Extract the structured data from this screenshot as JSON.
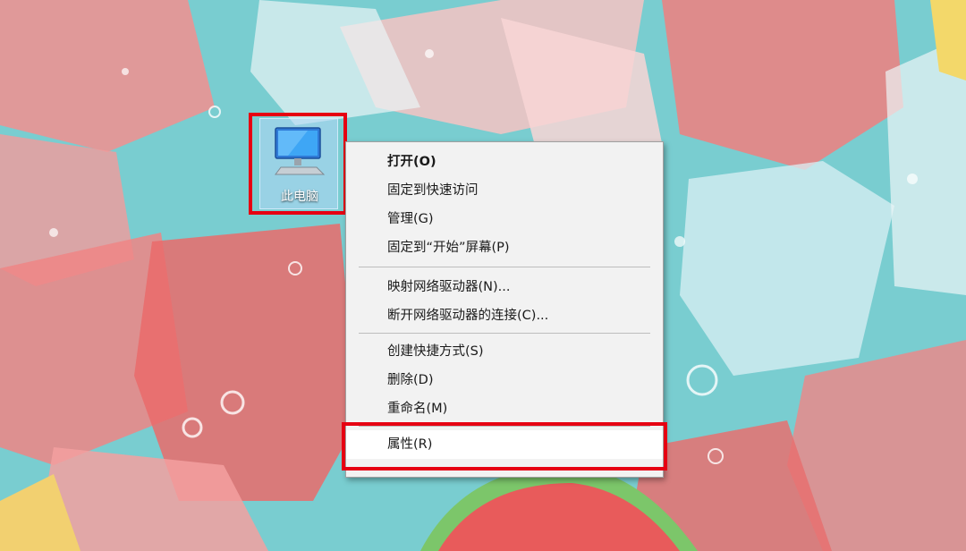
{
  "desktop": {
    "icon_label": "此电脑",
    "highlight_color": "#e60012"
  },
  "context_menu": {
    "groups": [
      [
        "打开(O)",
        "固定到快速访问",
        "管理(G)",
        "固定到“开始”屏幕(P)"
      ],
      [
        "映射网络驱动器(N)...",
        "断开网络驱动器的连接(C)..."
      ],
      [
        "创建快捷方式(S)",
        "删除(D)",
        "重命名(M)"
      ],
      [
        "属性(R)"
      ]
    ],
    "default_item": "打开(O)",
    "highlighted_item": "属性(R)"
  }
}
